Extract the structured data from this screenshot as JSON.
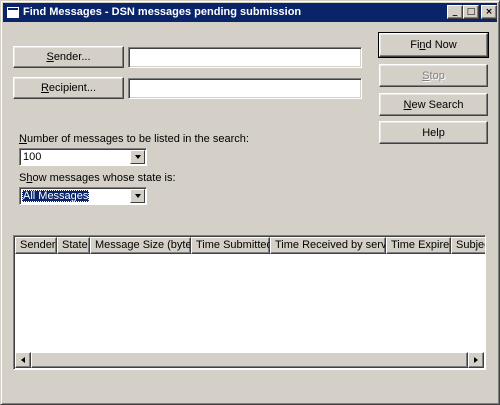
{
  "window": {
    "title": "Find Messages - DSN messages pending submission",
    "minimize_glyph": "_",
    "maximize_glyph": "□",
    "close_glyph": "×"
  },
  "criteria": {
    "sender_button": {
      "pre": "",
      "key": "S",
      "post": "ender..."
    },
    "sender_value": "",
    "recipient_button": {
      "pre": "",
      "key": "R",
      "post": "ecipient..."
    },
    "recipient_value": ""
  },
  "actions": {
    "find_now": {
      "pre": "Fi",
      "key": "n",
      "post": "d Now"
    },
    "stop": {
      "pre": "",
      "key": "S",
      "post": "top"
    },
    "new_search": {
      "pre": "",
      "key": "N",
      "post": "ew Search"
    },
    "help": "Help"
  },
  "options": {
    "count_label": {
      "pre": "",
      "key": "N",
      "post": "umber of messages to be listed in the search:"
    },
    "count_value": "100",
    "state_label": {
      "pre": "S",
      "key": "h",
      "post": "ow messages whose state is:"
    },
    "state_value": "All Messages"
  },
  "results": {
    "columns": [
      "Sender",
      "State",
      "Message Size (bytes)",
      "Time Submitted",
      "Time Received by server",
      "Time Expires",
      "Subject"
    ],
    "rows": []
  },
  "icons": {
    "scroll_left": "left-arrow",
    "scroll_right": "right-arrow",
    "dropdown": "down-arrow"
  }
}
